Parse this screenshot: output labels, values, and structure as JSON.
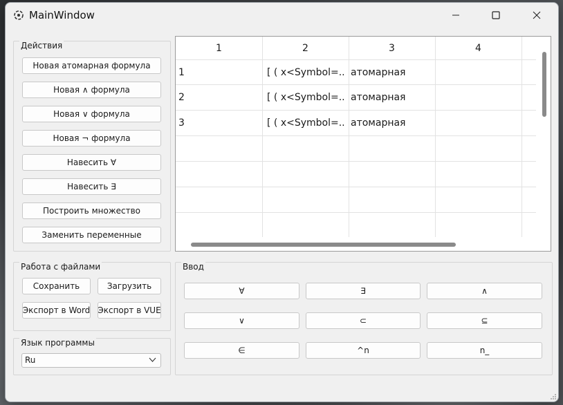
{
  "window": {
    "title": "MainWindow"
  },
  "actions": {
    "title": "Действия",
    "buttons": [
      "Новая атомарная формула",
      "Новая ∧ формула",
      "Новая ∨ формула",
      "Новая ¬ формула",
      "Навесить ∀",
      "Навесить ∃",
      "Построить множество",
      "Заменить переменные"
    ]
  },
  "files": {
    "title": "Работа с файлами",
    "save": "Сохранить",
    "load": "Загрузить",
    "export_word": "Экспорт в Word",
    "export_vue": "Экспорт в VUE"
  },
  "language": {
    "title": "Язык программы",
    "selected": "Ru"
  },
  "table": {
    "headers": [
      "1",
      "2",
      "3",
      "4"
    ],
    "rows": [
      [
        "1",
        "[ ( x<Symbol=...",
        "атомарная",
        ""
      ],
      [
        "2",
        "[ ( x<Symbol=...",
        "атомарная",
        ""
      ],
      [
        "3",
        "[ ( x<Symbol=...",
        "атомарная",
        ""
      ]
    ]
  },
  "input": {
    "title": "Ввод",
    "buttons": [
      "∀",
      "∃",
      "∧",
      "∨",
      "⊂",
      "⊆",
      "∈",
      "^n",
      "n_"
    ]
  }
}
